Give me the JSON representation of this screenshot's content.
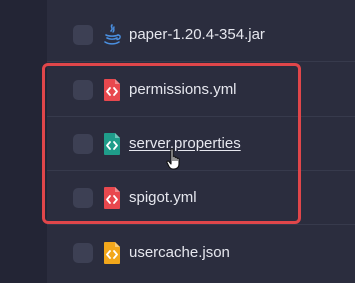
{
  "files": [
    {
      "name": "paper-1.20.4-354.jar",
      "icon": "java-icon",
      "icon_color": "#4a8fe0"
    },
    {
      "name": "permissions.yml",
      "icon": "code-file-icon",
      "icon_color": "#e8484e"
    },
    {
      "name": "server.properties",
      "icon": "code-file-icon",
      "icon_color": "#1f9d8a"
    },
    {
      "name": "spigot.yml",
      "icon": "code-file-icon",
      "icon_color": "#e8484e"
    },
    {
      "name": "usercache.json",
      "icon": "code-file-icon",
      "icon_color": "#f2a71b"
    }
  ],
  "highlight_color": "#e0464a",
  "hovered_file": "server.properties"
}
